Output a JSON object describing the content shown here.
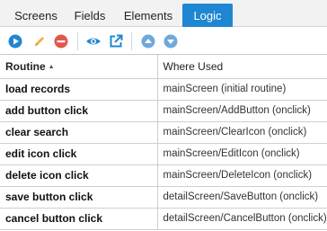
{
  "tabs": [
    {
      "label": "Screens",
      "active": false
    },
    {
      "label": "Fields",
      "active": false
    },
    {
      "label": "Elements",
      "active": false
    },
    {
      "label": "Logic",
      "active": true
    }
  ],
  "toolbar": {
    "buttons": [
      {
        "icon": "play-icon",
        "color": "#1f87d2"
      },
      {
        "icon": "pencil-icon",
        "color": "#f0b14a"
      },
      {
        "icon": "delete-icon",
        "color": "#e2574c"
      },
      {
        "icon": "eye-icon",
        "color": "#1f87d2"
      },
      {
        "icon": "external-link-icon",
        "color": "#1f87d2"
      },
      {
        "icon": "move-up-icon",
        "color": "#6ea8dc"
      },
      {
        "icon": "move-down-icon",
        "color": "#6ea8dc"
      }
    ]
  },
  "table": {
    "columns": {
      "routine": "Routine",
      "where_used": "Where Used"
    },
    "sort": {
      "column": "routine",
      "direction": "ascending"
    },
    "rows": [
      {
        "routine": "load records",
        "where_used": "mainScreen (initial routine)"
      },
      {
        "routine": "add button click",
        "where_used": "mainScreen/AddButton (onclick)"
      },
      {
        "routine": "clear search",
        "where_used": "mainScreen/ClearIcon (onclick)"
      },
      {
        "routine": "edit icon click",
        "where_used": "mainScreen/EditIcon (onclick)"
      },
      {
        "routine": "delete icon click",
        "where_used": "mainScreen/DeleteIcon (onclick)"
      },
      {
        "routine": "save button click",
        "where_used": "detailScreen/SaveButton (onclick)"
      },
      {
        "routine": "cancel button click",
        "where_used": "detailScreen/CancelButton (onclick)"
      }
    ]
  },
  "colors": {
    "accent": "#1f87d2",
    "edit": "#f0b14a",
    "delete": "#e2574c"
  }
}
